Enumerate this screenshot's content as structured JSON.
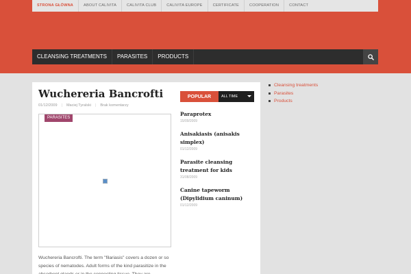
{
  "top_nav": {
    "items": [
      {
        "label": "STRONA GŁÓWNA",
        "active": true
      },
      {
        "label": "ABOUT CALIVITA",
        "active": false
      },
      {
        "label": "CALIVITA CLUB",
        "active": false
      },
      {
        "label": "CALIVITA EUROPE",
        "active": false
      },
      {
        "label": "CERTIFICATE",
        "active": false
      },
      {
        "label": "COOPERATION",
        "active": false
      },
      {
        "label": "CONTACT",
        "active": false
      }
    ]
  },
  "main_nav": {
    "items": [
      {
        "label": "CLEANSING TREATMENTS"
      },
      {
        "label": "PARASITES"
      },
      {
        "label": "PRODUCTS"
      }
    ],
    "search_icon": "search-icon"
  },
  "post": {
    "title": "Wuchereria Bancrofti",
    "date": "01/12/2009",
    "author": "Maciej Tyralski",
    "comments": "Brak komentarzy",
    "category": "PARASITES",
    "excerpt": "Wuchereria Bancrofti. The term \"filariasis\" covers a dozen or so species of nematodes. Adult forms of the kind parasitize in the absorbent glands or in the connecting tissue. They are"
  },
  "popular": {
    "tab_label": "POPULAR",
    "range_label": "ALL TIME",
    "items": [
      {
        "title": "Paraprotex",
        "date": "15/09/2009"
      },
      {
        "title": "Anisakiasis (anisakis simplex)",
        "date": "01/12/2009"
      },
      {
        "title": "Parasite cleansing treatment for kids",
        "date": "31/08/2009"
      },
      {
        "title": "Canine tapeworm (Dipylidium caninum)",
        "date": "01/12/2009"
      }
    ]
  },
  "sidebar": {
    "items": [
      {
        "label": "Cleansing treatments"
      },
      {
        "label": "Parasites"
      },
      {
        "label": "Products"
      }
    ]
  },
  "colors": {
    "brand": "#d9503a",
    "nav_dark": "#2d2d2d",
    "category_badge": "#a0466c"
  }
}
